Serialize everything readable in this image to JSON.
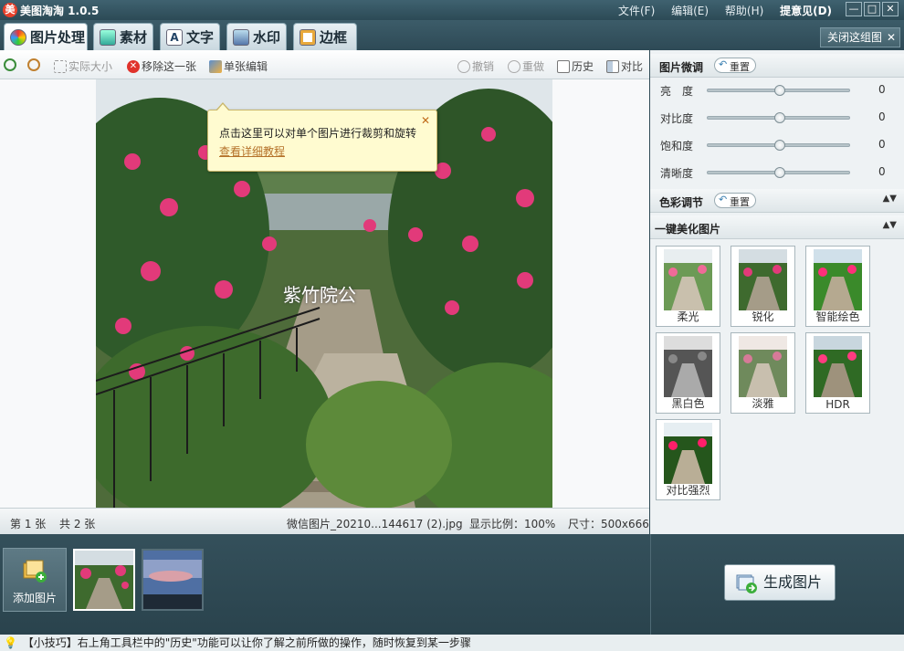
{
  "app": {
    "title": "美图淘淘 1.0.5"
  },
  "menu": {
    "file": "文件(F)",
    "edit": "编辑(E)",
    "help": "帮助(H)",
    "feedback": "提意见(D)"
  },
  "window_buttons": [
    "—",
    "□",
    "✕"
  ],
  "tabs": [
    {
      "label": "图片处理"
    },
    {
      "label": "素材"
    },
    {
      "label": "文字"
    },
    {
      "label": "水印"
    },
    {
      "label": "边框"
    }
  ],
  "close_group": {
    "label": "关闭这组图",
    "x": "✕"
  },
  "toolbar": {
    "actual_size": "实际大小",
    "remove": "移除这一张",
    "single_edit": "单张编辑",
    "undo": "撤销",
    "redo": "重做",
    "history": "历史",
    "compare": "对比"
  },
  "tooltip": {
    "text": "点击这里可以对单个图片进行裁剪和旋转",
    "link": "查看详细教程",
    "close": "✕"
  },
  "image": {
    "watermark": "紫竹院公"
  },
  "statusbar": {
    "current": "第 1 张",
    "total": "共 2 张",
    "filename": "微信图片_20210...144617 (2).jpg",
    "ratio": "显示比例：100%",
    "size": "尺寸：500x666"
  },
  "adjust": {
    "title": "图片微调",
    "reset": "重置",
    "sliders": [
      {
        "label": "亮　度",
        "value": "0"
      },
      {
        "label": "对比度",
        "value": "0"
      },
      {
        "label": "饱和度",
        "value": "0"
      },
      {
        "label": "清晰度",
        "value": "0"
      }
    ]
  },
  "color": {
    "title": "色彩调节",
    "reset": "重置",
    "toggle": "▲▼"
  },
  "beautify": {
    "title": "一键美化图片",
    "toggle": "▲▼",
    "effects": [
      {
        "label": "柔光",
        "tone": "normal"
      },
      {
        "label": "锐化",
        "tone": "normal"
      },
      {
        "label": "智能绘色",
        "tone": "vivid"
      },
      {
        "label": "黑白色",
        "tone": "bw"
      },
      {
        "label": "淡雅",
        "tone": "soft"
      },
      {
        "label": "HDR",
        "tone": "hdr"
      },
      {
        "label": "对比强烈",
        "tone": "contrast"
      }
    ]
  },
  "bottom": {
    "add_image": "添加图片",
    "generate": "生成图片"
  },
  "tip": {
    "text": "【小技巧】右上角工具栏中的\"历史\"功能可以让你了解之前所做的操作，随时恢复到某一步骤"
  },
  "colors": {
    "title_bg": "#2c4a56",
    "tooltip_bg": "#fffbd0",
    "link": "#b5722a"
  }
}
